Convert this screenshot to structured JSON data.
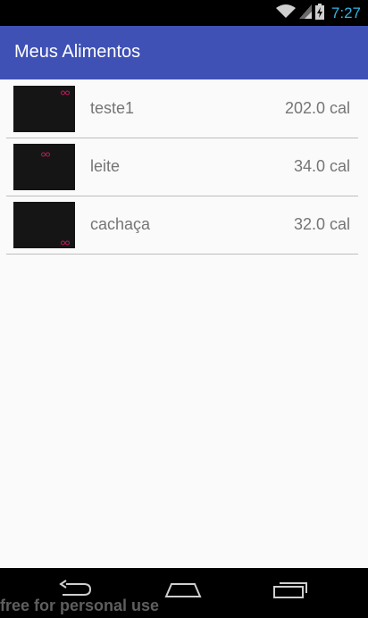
{
  "status": {
    "time": "7:27"
  },
  "app": {
    "title": "Meus Alimentos"
  },
  "items": [
    {
      "name": "teste1",
      "calories": "202.0 cal"
    },
    {
      "name": "leite",
      "calories": "34.0 cal"
    },
    {
      "name": "cachaça",
      "calories": "32.0 cal"
    }
  ],
  "watermark": "free for personal use",
  "colors": {
    "appbar": "#3f51b5",
    "status_text": "#33b5e5",
    "item_text": "#757575"
  },
  "icons": [
    "wifi-icon",
    "signal-icon",
    "battery-charging-icon",
    "back-icon",
    "home-icon",
    "recents-icon"
  ]
}
